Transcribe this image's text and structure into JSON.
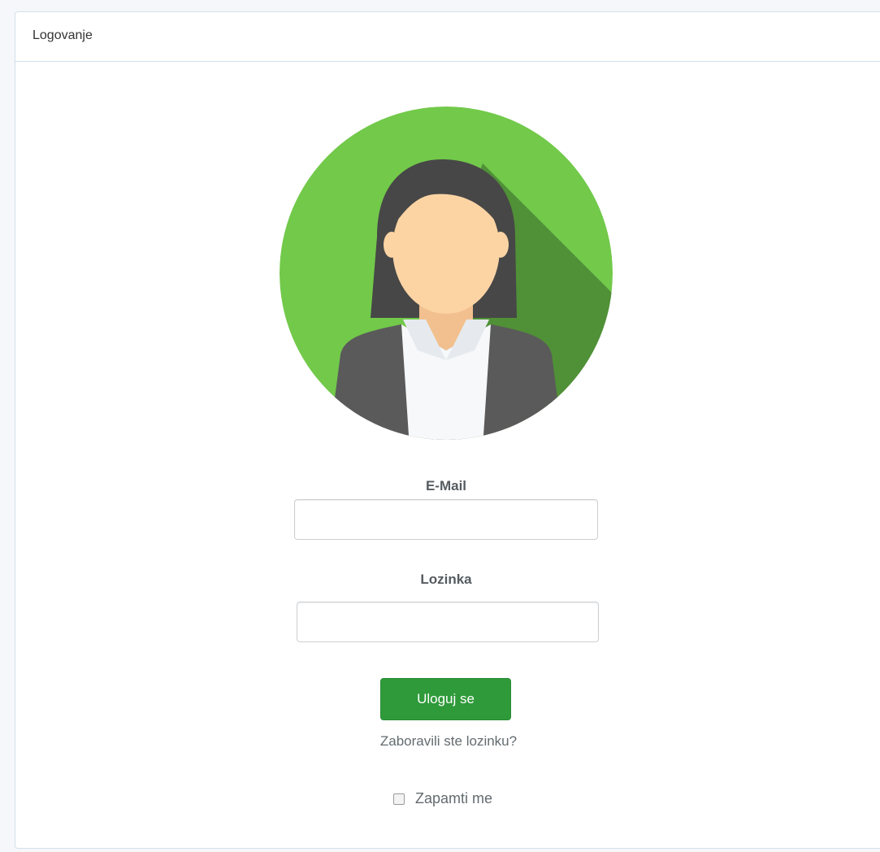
{
  "panel": {
    "title": "Logovanje"
  },
  "avatar": {
    "icon": "woman-avatar-icon",
    "colors": {
      "circle": "#72c94a",
      "shadow": "#4c8a35",
      "hair": "#474747",
      "skin": "#fcd4a4",
      "jacket": "#5a5a5a",
      "shirt": "#f6f8fa"
    }
  },
  "form": {
    "email_label": "E-Mail",
    "email_value": "",
    "password_label": "Lozinka",
    "password_value": "",
    "login_button": "Uloguj se",
    "forgot_link": "Zaboravili ste lozinku?",
    "remember_label": "Zapamti me",
    "remember_checked": false
  },
  "colors": {
    "primary_button": "#2f9a3a",
    "panel_border": "#d3e0e9"
  }
}
